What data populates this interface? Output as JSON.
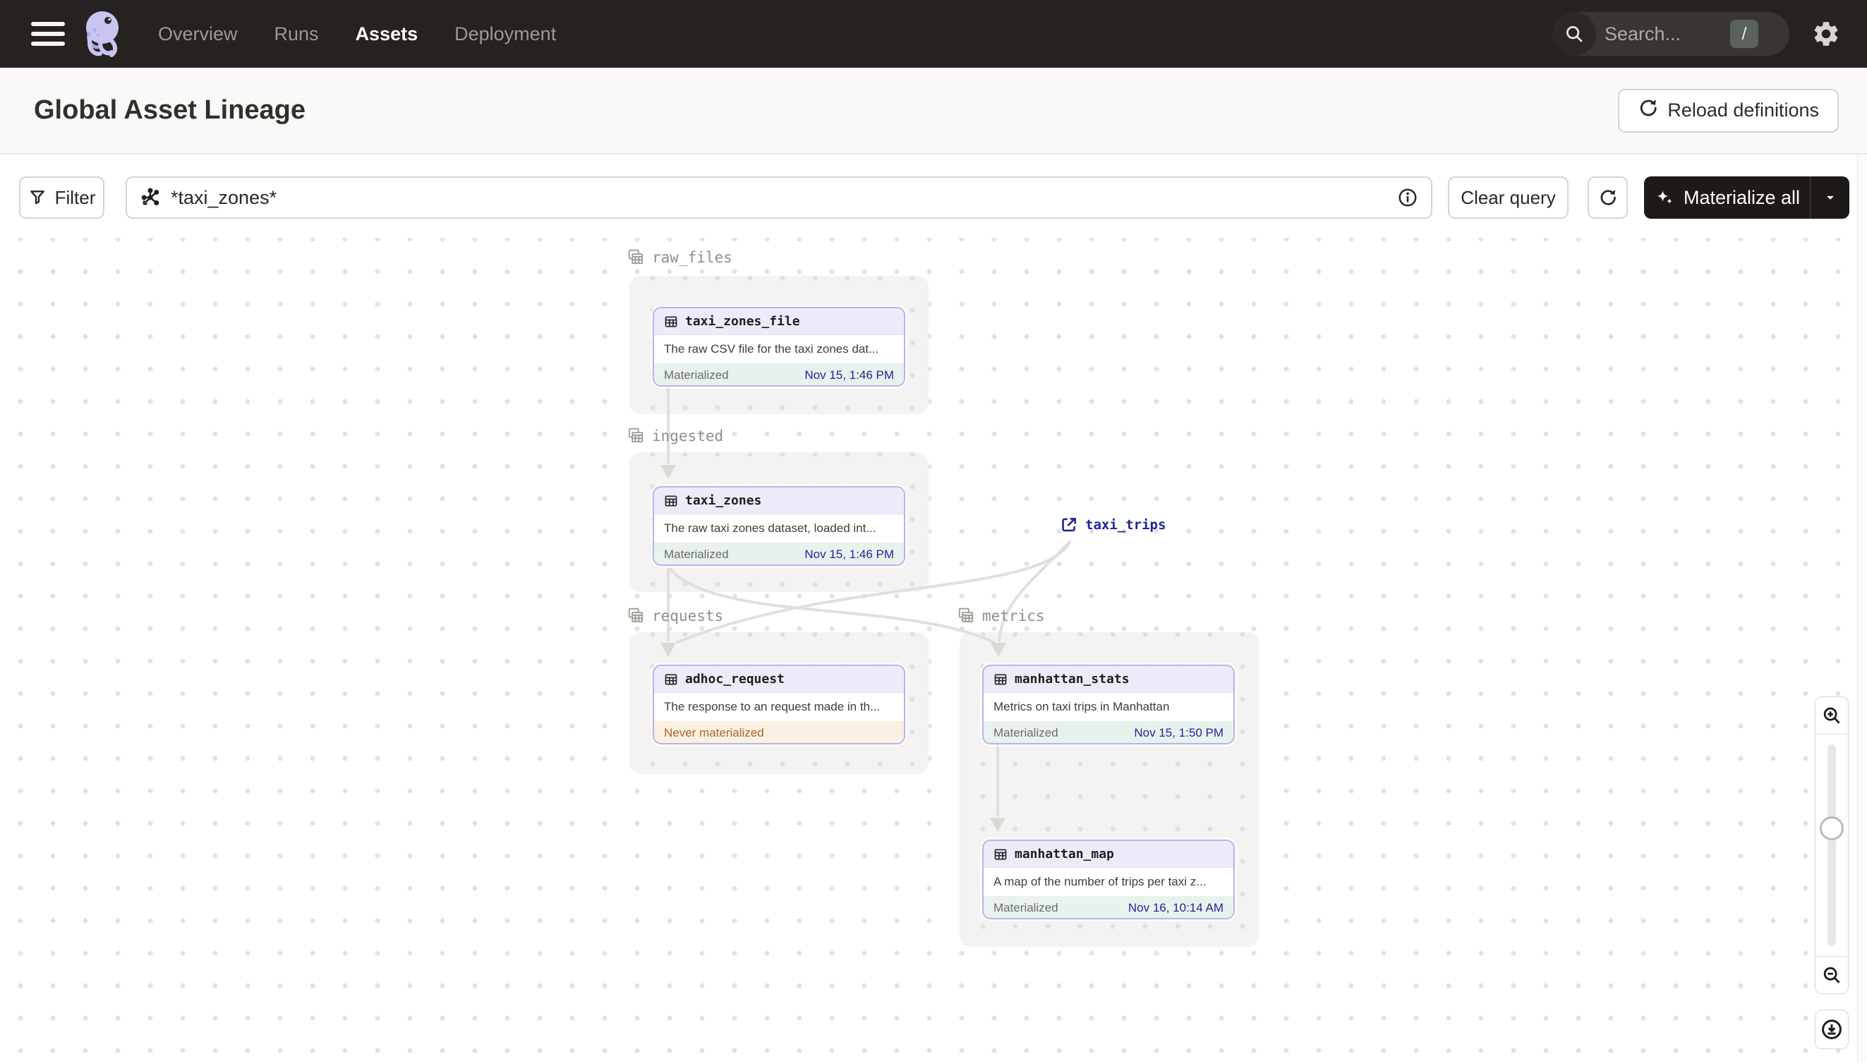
{
  "nav": {
    "menu_items": [
      {
        "label": "Overview",
        "active": false
      },
      {
        "label": "Runs",
        "active": false
      },
      {
        "label": "Assets",
        "active": true
      },
      {
        "label": "Deployment",
        "active": false
      }
    ],
    "search": {
      "placeholder": "Search...",
      "shortcut": "/"
    }
  },
  "header": {
    "title": "Global Asset Lineage",
    "reload_label": "Reload definitions"
  },
  "toolbar": {
    "filter_label": "Filter",
    "query_value": "*taxi_zones*",
    "clear_label": "Clear query",
    "materialize_label": "Materialize all"
  },
  "graph": {
    "groups": [
      {
        "name": "raw_files"
      },
      {
        "name": "ingested"
      },
      {
        "name": "requests"
      },
      {
        "name": "metrics"
      }
    ],
    "nodes": [
      {
        "title": "taxi_zones_file",
        "group": "raw_files",
        "description": "The raw CSV file for the taxi zones dat...",
        "status": "Materialized",
        "timestamp": "Nov 15, 1:46 PM"
      },
      {
        "title": "taxi_zones",
        "group": "ingested",
        "description": "The raw taxi zones dataset, loaded int...",
        "status": "Materialized",
        "timestamp": "Nov 15, 1:46 PM"
      },
      {
        "title": "adhoc_request",
        "group": "requests",
        "description": "The response to an request made in th...",
        "status": "Never materialized",
        "timestamp": ""
      },
      {
        "title": "manhattan_stats",
        "group": "metrics",
        "description": "Metrics on taxi trips in Manhattan",
        "status": "Materialized",
        "timestamp": "Nov 15, 1:50 PM"
      },
      {
        "title": "manhattan_map",
        "group": "metrics",
        "description": "A map of the number of trips per taxi z...",
        "status": "Materialized",
        "timestamp": "Nov 16, 10:14 AM"
      }
    ],
    "external_assets": [
      {
        "title": "taxi_trips"
      }
    ]
  },
  "colors": {
    "navbar_bg": "#262220",
    "accent_purple_border": "#B8B2EE",
    "node_header_bg": "#EDEBFA",
    "success_footer_bg": "#E8F2ED",
    "timestamp_text": "#23249B",
    "warning_footer_bg": "#FAF0E1",
    "warning_text": "#AF6325",
    "external_link_text": "#1D2796",
    "edge_stroke": "#E1DFDC",
    "shortcut_badge_bg": "#5A635A"
  }
}
